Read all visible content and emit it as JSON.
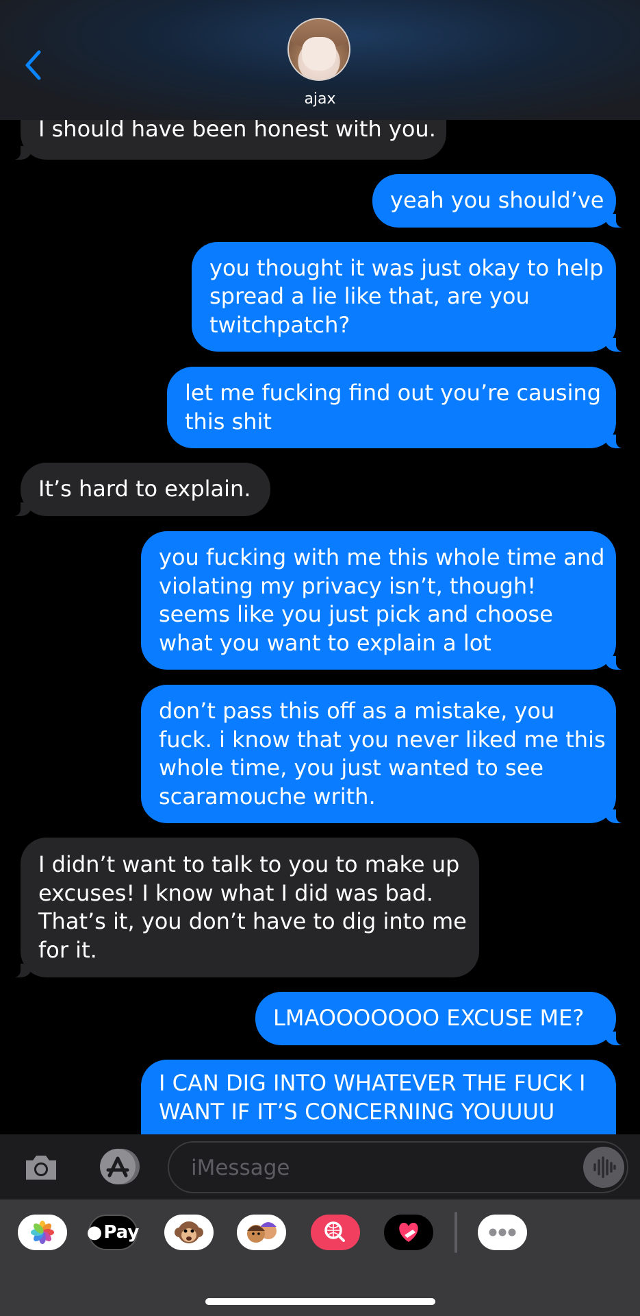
{
  "header": {
    "contact_name": "ajax",
    "colors": {
      "accent": "#0a84ff"
    }
  },
  "messages": [
    {
      "direction": "incoming",
      "lines": [
        "I should have been honest with you."
      ]
    },
    {
      "direction": "outgoing",
      "lines": [
        "yeah you should’ve"
      ]
    },
    {
      "direction": "outgoing",
      "lines": [
        "you thought it was just okay to help",
        "spread a lie like that, are you",
        "twitchpatch?"
      ]
    },
    {
      "direction": "outgoing",
      "lines": [
        "let me fucking find out you’re causing",
        "this shit"
      ]
    },
    {
      "direction": "incoming",
      "lines": [
        "It’s hard to explain."
      ]
    },
    {
      "direction": "outgoing",
      "lines": [
        "you fucking with me this whole time and",
        "violating my privacy isn’t, though!",
        "seems like you just pick and choose",
        "what you want to explain a lot"
      ]
    },
    {
      "direction": "outgoing",
      "lines": [
        "don’t pass this off as a mistake, you",
        "fuck. i know that you never liked me this",
        "whole time, you just wanted to see",
        "scaramouche writh."
      ]
    },
    {
      "direction": "incoming",
      "lines": [
        "I didn’t want to talk to you to make up",
        "excuses! I know what I did was bad.",
        "That’s it, you don’t have to dig into me",
        "for it."
      ]
    },
    {
      "direction": "outgoing",
      "lines": [
        "LMAOOOOOOO EXCUSE ME?"
      ]
    },
    {
      "direction": "outgoing",
      "lines": [
        "I CAN DIG INTO WHATEVER THE FUCK I",
        "WANT IF IT’S CONCERNING YOUUUU"
      ]
    }
  ],
  "compose": {
    "placeholder": "iMessage"
  },
  "app_drawer": {
    "apple_pay_label": "Pay",
    "apps": [
      "photos-icon",
      "apple-pay-icon",
      "animoji-icon",
      "memoji-icon",
      "image-search-icon",
      "digital-touch-icon",
      "more-icon"
    ]
  },
  "colors": {
    "incoming_bubble": "#262628",
    "outgoing_bubble": "#0a7cff",
    "background": "#000000"
  }
}
